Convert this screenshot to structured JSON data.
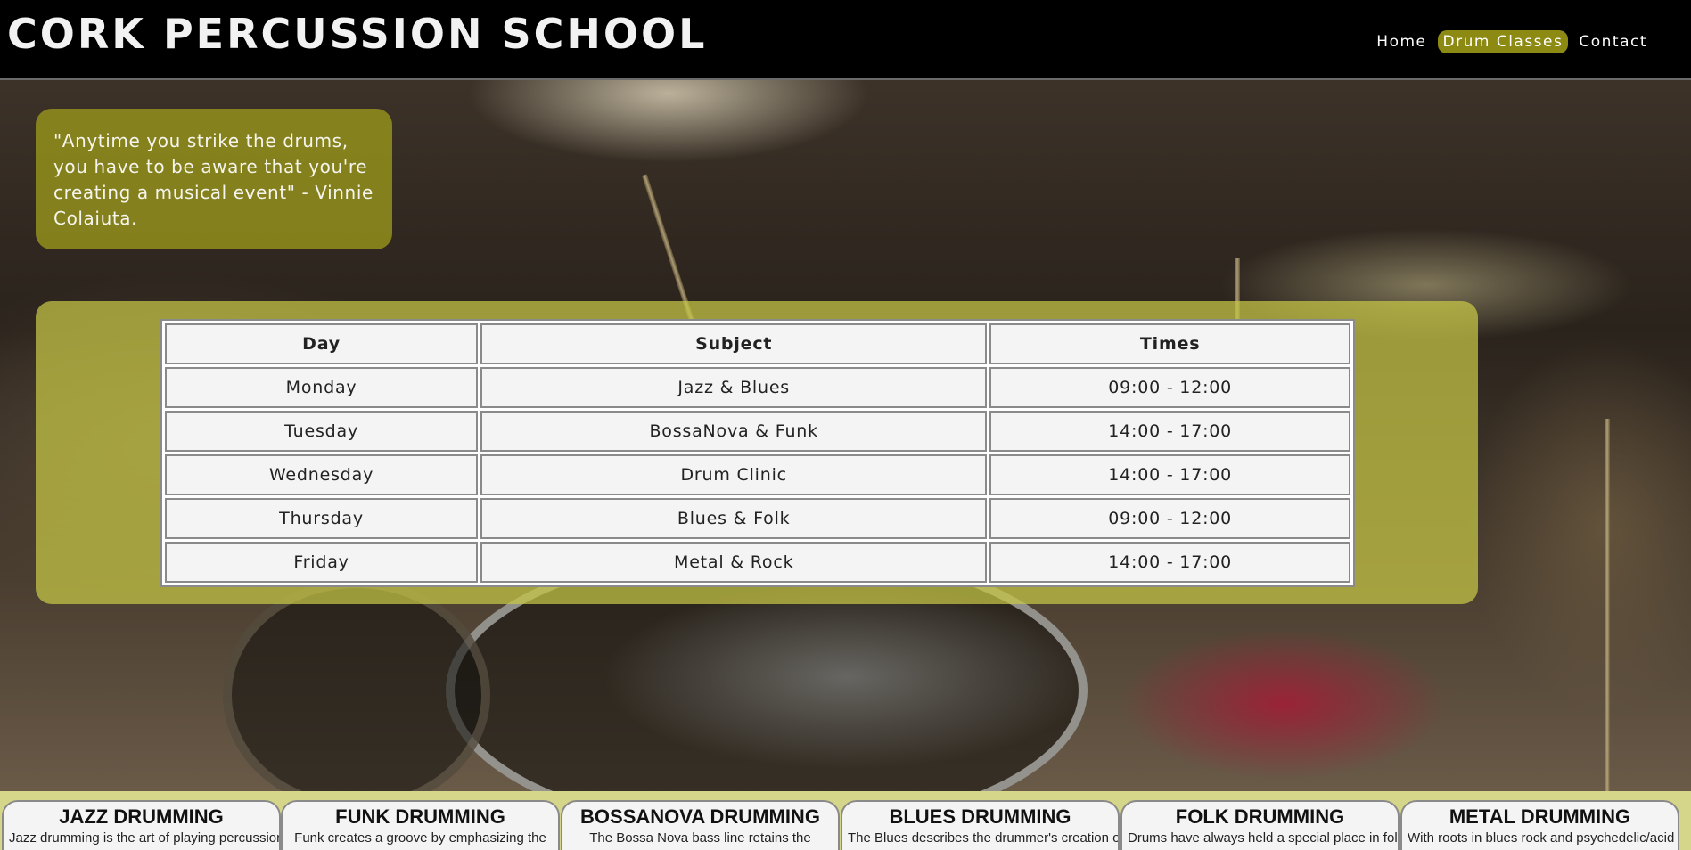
{
  "header": {
    "title": "CORK PERCUSSION SCHOOL",
    "nav": [
      {
        "label": "Home",
        "active": false
      },
      {
        "label": "Drum Classes",
        "active": true
      },
      {
        "label": "Contact",
        "active": false
      }
    ],
    "accent_color": "#8c8a12"
  },
  "quote": {
    "text": "\"Anytime you strike the drums, you have to be aware that you're creating a musical event\" - Vinnie Colaiuta."
  },
  "schedule": {
    "headers": [
      "Day",
      "Subject",
      "Times"
    ],
    "rows": [
      [
        "Monday",
        "Jazz & Blues",
        "09:00 - 12:00"
      ],
      [
        "Tuesday",
        "BossaNova & Funk",
        "14:00 - 17:00"
      ],
      [
        "Wednesday",
        "Drum Clinic",
        "14:00 - 17:00"
      ],
      [
        "Thursday",
        "Blues & Folk",
        "09:00 - 12:00"
      ],
      [
        "Friday",
        "Metal & Rock",
        "14:00 - 17:00"
      ]
    ]
  },
  "cards": [
    {
      "title": "JAZZ DRUMMING",
      "text": "Jazz drumming is the art of playing percussion"
    },
    {
      "title": "FUNK DRUMMING",
      "text": "Funk creates a groove by emphasizing the"
    },
    {
      "title": "BOSSANOVA DRUMMING",
      "text": "The Bossa Nova bass line retains the"
    },
    {
      "title": "BLUES DRUMMING",
      "text": "The Blues describes the drummer's creation of a"
    },
    {
      "title": "FOLK DRUMMING",
      "text": "Drums have always held a special place in folk"
    },
    {
      "title": "METAL DRUMMING",
      "text": "With roots in blues rock and psychedelic/acid"
    }
  ]
}
